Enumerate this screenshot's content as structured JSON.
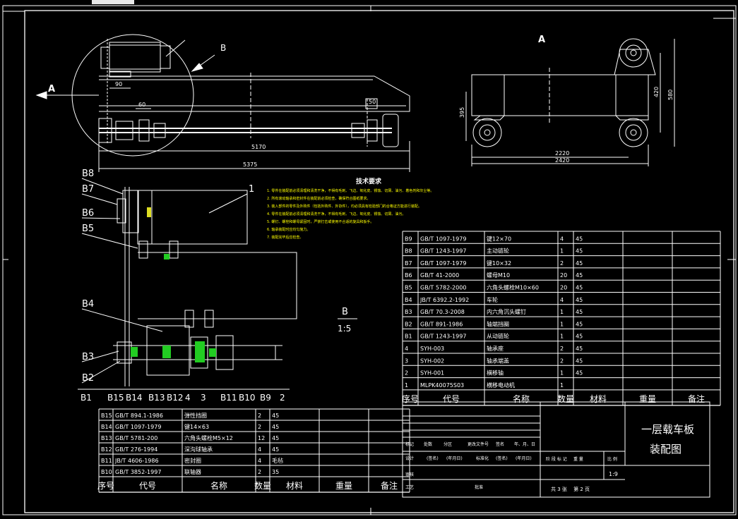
{
  "drawing": {
    "title_line1": "一层载车板",
    "title_line2": "装配图",
    "scale": "1:9",
    "sheet_info": "共 3 张　 第 2 页",
    "view_a": "A",
    "view_b": "B",
    "detail_b": "B",
    "detail_scale": "1:5",
    "arrow_a": "A",
    "tech_title": "技术要求",
    "tech_notes": [
      "1. 零件在装配前必须清理和清洗干净，不得有毛刺、飞边、氧化皮、锈蚀、切屑、油污、着色剂和灰尘等。",
      "2. 所有滚动轴承和密封件在装配前必须检查，确保符合图纸要求。",
      "3. 装入部件的零件及外购件（包括外购件、外协件），均必须具有检验部门的合格证方能进行装配。",
      "4. 零件在装配前必须清理和清洗干净，不得有毛刺、飞边、氧化皮、锈蚀、切屑、油污。",
      "5. 螺钉、螺栓和螺母紧固时，严禁打击或使用不合适的旋具和扳手。",
      "6. 轴承装配时应均匀施力。",
      "7. 装配完毕后应检查。"
    ]
  },
  "dimensions": {
    "d90": "90",
    "d60": "60",
    "d50": "50",
    "d5170": "5170",
    "d5375": "5375",
    "d2220": "2220",
    "d2420": "2420",
    "d420": "420",
    "d580": "580",
    "d395": "395"
  },
  "balloons": {
    "b8": "B8",
    "b7": "B7",
    "b6": "B6",
    "b5": "B5",
    "b4": "B4",
    "b3": "B3",
    "b2": "B2",
    "b1": "B1",
    "n1": "1",
    "bottom": [
      "B1",
      "B15",
      "B14",
      "B13",
      "B12",
      "4",
      "3",
      "B11",
      "B10",
      "B9",
      "2"
    ]
  },
  "bom_right": {
    "rows": [
      [
        "B9",
        "GB/T 1097-1979",
        "键12×70",
        "4",
        "45",
        ""
      ],
      [
        "B8",
        "GB/T 1243-1997",
        "主动链轮",
        "1",
        "45",
        ""
      ],
      [
        "B7",
        "GB/T 1097-1979",
        "键10×32",
        "2",
        "45",
        ""
      ],
      [
        "B6",
        "GB/T 41-2000",
        "螺母M10",
        "20",
        "45",
        ""
      ],
      [
        "B5",
        "GB/T 5782-2000",
        "六角头螺栓M10×60",
        "20",
        "45",
        ""
      ],
      [
        "B4",
        "JB/T 6392.2-1992",
        "车轮",
        "4",
        "45",
        ""
      ],
      [
        "B3",
        "GB/T 70.3-2008",
        "内六角沉头螺钉",
        "1",
        "45",
        ""
      ],
      [
        "B2",
        "GB/T 891-1986",
        "轴端挡圈",
        "1",
        "45",
        ""
      ],
      [
        "B1",
        "GB/T 1243-1997",
        "从动链轮",
        "1",
        "45",
        ""
      ],
      [
        "4",
        "SYH-003",
        "轴承座",
        "2",
        "45",
        ""
      ],
      [
        "3",
        "SYH-002",
        "轴承端盖",
        "2",
        "45",
        ""
      ],
      [
        "2",
        "SYH-001",
        "横移轴",
        "1",
        "45",
        ""
      ],
      [
        "1",
        "MLPK40075S03",
        "横移电动机",
        "1",
        "",
        ""
      ]
    ],
    "header": [
      "序号",
      "代号",
      "名称",
      "数量",
      "材料",
      "重量",
      "备注"
    ]
  },
  "bom_left": {
    "rows": [
      [
        "B15",
        "GB/T 894.1-1986",
        "弹性挡圈",
        "2",
        "45",
        ""
      ],
      [
        "B14",
        "GB/T 1097-1979",
        "键14×63",
        "2",
        "45",
        ""
      ],
      [
        "B13",
        "GB/T 5781-200",
        "六角头螺栓M5×12",
        "12",
        "45",
        ""
      ],
      [
        "B12",
        "GB/T 276-1994",
        "深沟球轴承",
        "4",
        "45",
        ""
      ],
      [
        "B11",
        "JB/T 4606-1986",
        "密封圈",
        "4",
        "毛毡",
        ""
      ],
      [
        "B10",
        "GB/T 3852-1997",
        "联轴器",
        "2",
        "35",
        ""
      ]
    ],
    "header": [
      "序号",
      "代号",
      "名称",
      "数量",
      "材料",
      "重量",
      "备注"
    ]
  },
  "title_block": {
    "r1": [
      "标记",
      "处数",
      "分区",
      "更改文件号",
      "签名",
      "年、月、日"
    ],
    "r2": [
      "设计",
      "(签名)",
      "(年月日)",
      "标准化",
      "(签名)",
      "(年月日)"
    ],
    "r3": [
      "审核"
    ],
    "r4": [
      "工艺",
      "批准"
    ],
    "stage": [
      "阶 段 标 记",
      "重 量",
      "比 例"
    ]
  }
}
